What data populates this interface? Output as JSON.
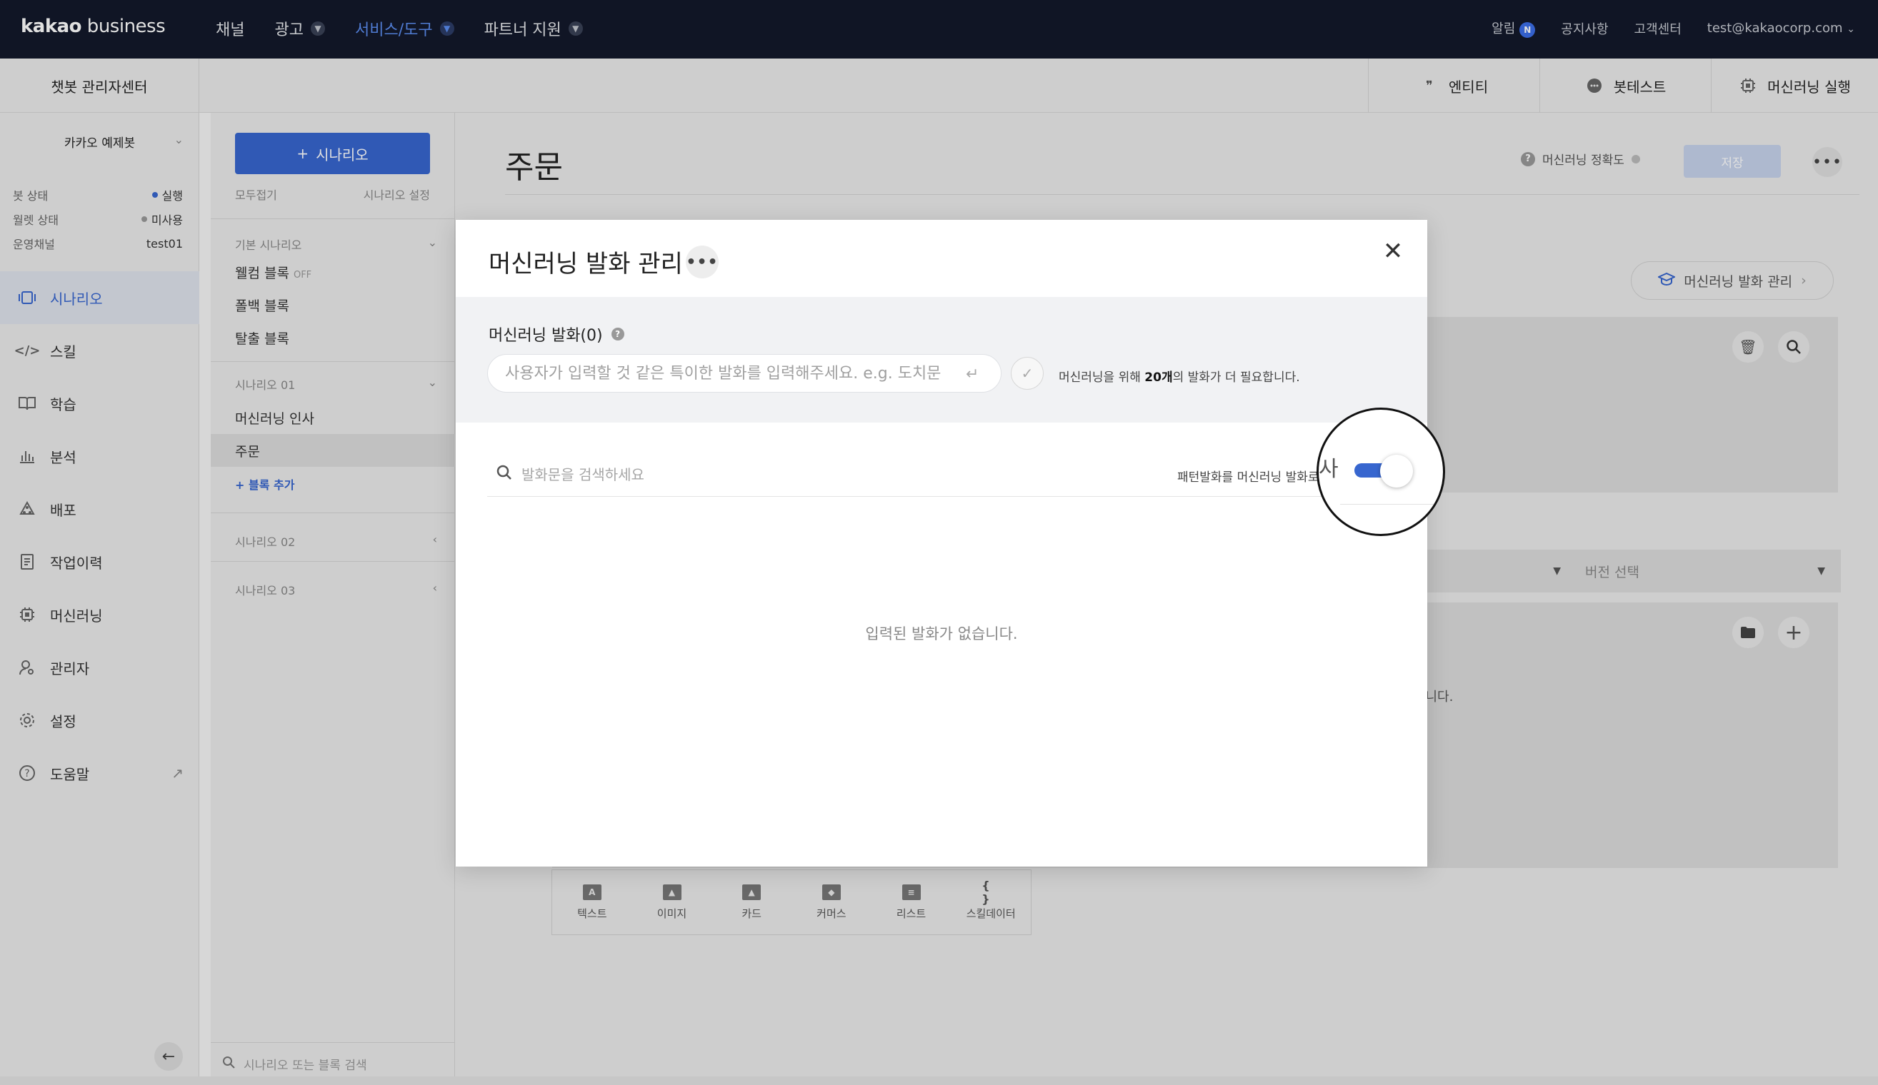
{
  "topnav": {
    "logo_bold": "kakao",
    "logo_light": " business",
    "menu": [
      {
        "label": "채널"
      },
      {
        "label": "광고"
      },
      {
        "label": "서비스/도구"
      },
      {
        "label": "파트너 지원"
      }
    ],
    "util": {
      "alarm": "알림",
      "alarm_badge": "N",
      "notice": "공지사항",
      "support": "고객센터",
      "account": "test@kakaocorp.com"
    }
  },
  "subheader": {
    "title": "챗봇 관리자센터",
    "tools": {
      "entity": "엔티티",
      "bottest": "봇테스트",
      "ml_run": "머신러닝 실행"
    }
  },
  "sidebar": {
    "bot_name": "카카오 예제봇",
    "status": [
      {
        "label": "봇 상태",
        "value": "실행",
        "color": "#3766cf"
      },
      {
        "label": "월렛 상태",
        "value": "미사용",
        "color": "#999999"
      },
      {
        "label": "운영채널",
        "value": "test01"
      }
    ],
    "nav": [
      {
        "label": "시나리오",
        "icon": "scenario-icon"
      },
      {
        "label": "스킬",
        "icon": "code-icon"
      },
      {
        "label": "학습",
        "icon": "book-icon"
      },
      {
        "label": "분석",
        "icon": "chart-icon"
      },
      {
        "label": "배포",
        "icon": "deploy-icon"
      },
      {
        "label": "작업이력",
        "icon": "history-icon"
      },
      {
        "label": "머신러닝",
        "icon": "chip-icon"
      },
      {
        "label": "관리자",
        "icon": "user-icon"
      },
      {
        "label": "설정",
        "icon": "gear-icon"
      },
      {
        "label": "도움말",
        "icon": "help-icon"
      }
    ]
  },
  "scenario_panel": {
    "add_button": "시나리오",
    "fold_all": "모두접기",
    "settings": "시나리오 설정",
    "basic_group": "기본 시나리오",
    "welcome": "웰컴 블록",
    "welcome_off": "OFF",
    "fallback": "폴백 블록",
    "exit": "탈출 블록",
    "scen01": "시나리오 01",
    "ml_greeting": "머신러닝 인사",
    "order": "주문",
    "add_block": "+ 블록 추가",
    "scen02": "시나리오 02",
    "scen03": "시나리오 03",
    "search_placeholder": "시나리오 또는 블록 검색"
  },
  "main": {
    "title": "주문",
    "ml_accuracy": "머신러닝 정확도",
    "save": "저장",
    "ml_manage": "머신러닝 발화 관리",
    "version_select": "버전 선택",
    "no_params": "필수 파라미터가 없습니다.",
    "toolbar": [
      {
        "label": "텍스트",
        "glyph": "A"
      },
      {
        "label": "이미지",
        "glyph": "▲"
      },
      {
        "label": "카드",
        "glyph": "▲"
      },
      {
        "label": "커머스",
        "glyph": "◆"
      },
      {
        "label": "리스트",
        "glyph": "≡"
      },
      {
        "label": "스킬데이터",
        "glyph": "{ }"
      }
    ]
  },
  "modal": {
    "title": "머신러닝 발화 관리",
    "section_label": "머신러닝 발화(0)",
    "input_placeholder": "사용자가 입력할 것 같은 특이한 발화를 입력해주세요. e.g. 도치문",
    "need_prefix": "머신러닝을 위해 ",
    "need_count": "20개",
    "need_suffix": "의 발화가 더 필요합니다.",
    "search_placeholder": "발화문을 검색하세요",
    "toggle_label": "패턴발화를 머신러닝 발화로",
    "toggle_ghost": "사",
    "empty": "입력된 발화가 없습니다."
  }
}
